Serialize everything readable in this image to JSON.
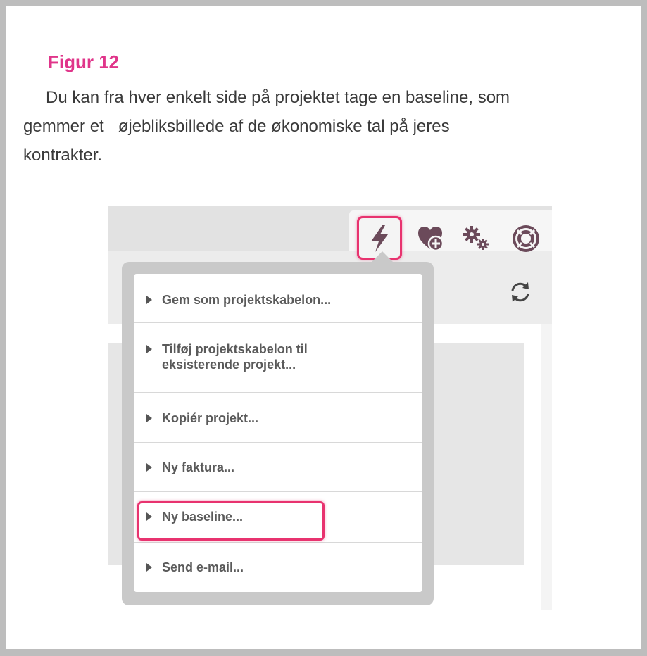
{
  "figure": {
    "title": "Figur 12",
    "line1": "Du kan fra hver enkelt side på projektet tage en baseline, som",
    "line2": "gemmer et   øjebliksbillede af de økonomiske tal på jeres",
    "line3": "kontrakter."
  },
  "toolbar": {
    "icons": [
      "lightning-icon",
      "heart-plus-icon",
      "gears-icon",
      "lifebuoy-icon",
      "refresh-icon"
    ],
    "highlight_color": "#e8336f"
  },
  "menu": {
    "items": [
      {
        "label": "Gem som projektskabelon..."
      },
      {
        "label_line1": "Tilføj projektskabelon til",
        "label_line2": "eksisterende projekt..."
      },
      {
        "label": "Kopiér projekt..."
      },
      {
        "label": "Ny faktura..."
      },
      {
        "label": "Ny baseline..."
      },
      {
        "label": "Send e-mail..."
      }
    ]
  },
  "colors": {
    "title": "#e0358a",
    "highlight": "#e8336f",
    "icon": "#6b4a5a"
  }
}
